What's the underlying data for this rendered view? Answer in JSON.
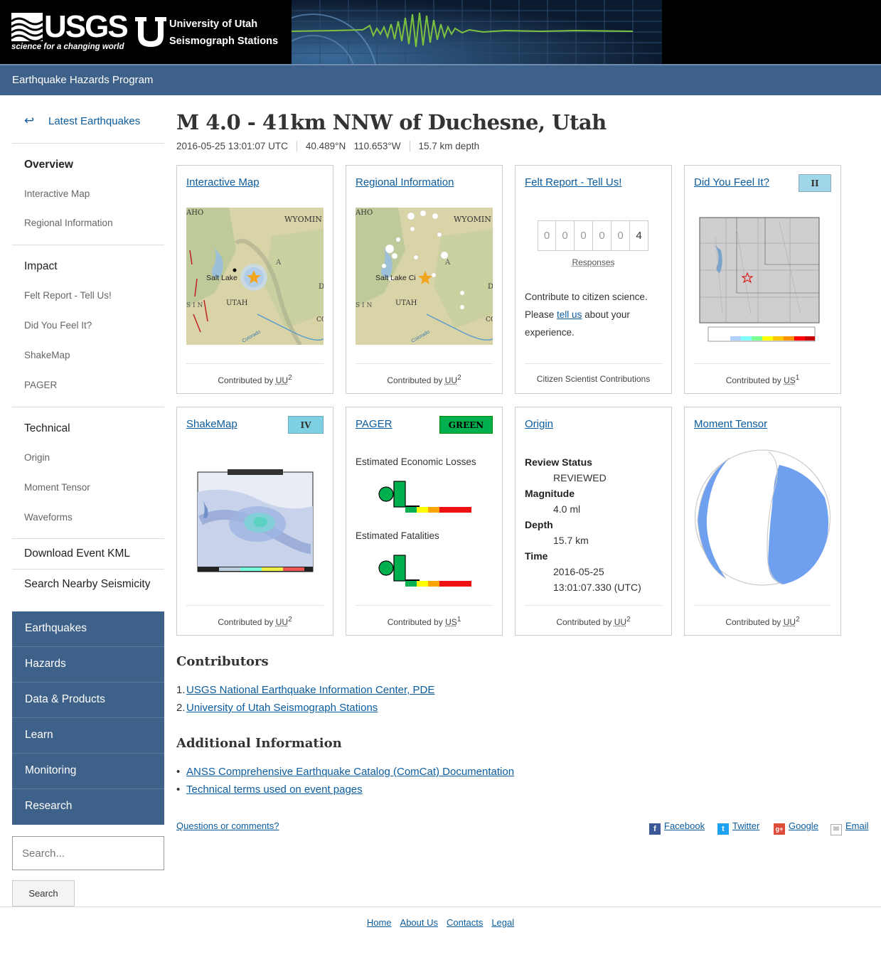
{
  "header": {
    "usgs_logo": "USGS",
    "usgs_tagline": "science for a changing world",
    "uu_line1": "University of Utah",
    "uu_line2": "Seismograph Stations",
    "program": "Earthquake Hazards Program"
  },
  "sidebar": {
    "back_label": "Latest Earthquakes",
    "overview": "Overview",
    "overview_items": [
      "Interactive Map",
      "Regional Information"
    ],
    "impact": "Impact",
    "impact_items": [
      "Felt Report - Tell Us!",
      "Did You Feel It?",
      "ShakeMap",
      "PAGER"
    ],
    "technical": "Technical",
    "technical_items": [
      "Origin",
      "Moment Tensor",
      "Waveforms"
    ],
    "download_kml": "Download Event KML",
    "search_nearby": "Search Nearby Seismicity",
    "section_nav": [
      "Earthquakes",
      "Hazards",
      "Data & Products",
      "Learn",
      "Monitoring",
      "Research"
    ],
    "search_placeholder": "Search...",
    "search_button": "Search"
  },
  "event": {
    "title": "M 4.0 - 41km NNW of Duchesne, Utah",
    "time": "2016-05-25 13:01:07 UTC",
    "lat": "40.489°N",
    "lon": "110.653°W",
    "depth": "15.7 km depth"
  },
  "cards": {
    "interactive_map": {
      "title": "Interactive Map",
      "contrib": "Contributed by",
      "network": "UU",
      "num": "2"
    },
    "regional": {
      "title": "Regional Information",
      "contrib": "Contributed by",
      "network": "UU",
      "num": "2"
    },
    "felt": {
      "title": "Felt Report - Tell Us!",
      "digits": [
        "0",
        "0",
        "0",
        "0",
        "0",
        "4"
      ],
      "responses": "Responses",
      "text1": "Contribute to citizen science.",
      "text2": "Please",
      "link": "tell us",
      "text3": "about your",
      "text4": "experience.",
      "footer": "Citizen Scientist Contributions"
    },
    "dyfi": {
      "title": "Did You Feel It?",
      "badge": "II",
      "contrib": "Contributed by",
      "network": "US",
      "num": "1"
    },
    "shakemap": {
      "title": "ShakeMap",
      "badge": "IV",
      "contrib": "Contributed by",
      "network": "UU",
      "num": "2"
    },
    "pager": {
      "title": "PAGER",
      "badge": "GREEN",
      "losses": "Estimated Economic Losses",
      "fatalities": "Estimated Fatalities",
      "contrib": "Contributed by",
      "network": "US",
      "num": "1"
    },
    "origin": {
      "title": "Origin",
      "review_label": "Review Status",
      "review": "REVIEWED",
      "mag_label": "Magnitude",
      "mag": "4.0 ml",
      "depth_label": "Depth",
      "depth": "15.7 km",
      "time_label": "Time",
      "date": "2016-05-25",
      "time": "13:01:07.330 (UTC)",
      "contrib": "Contributed by",
      "network": "UU",
      "num": "2"
    },
    "moment": {
      "title": "Moment Tensor",
      "contrib": "Contributed by",
      "network": "UU",
      "num": "2"
    }
  },
  "map_labels": {
    "idaho": "AHO",
    "wyoming": "WYOMIN",
    "saltlake": "Salt Lake",
    "saltlake2": "Salt Lake Ci",
    "utah": "UTAH",
    "colorado": "Colorado",
    "a": "A",
    "d": "D",
    "co": "CO",
    "sin": "S I N"
  },
  "contributors": {
    "heading": "Contributors",
    "items": [
      "USGS National Earthquake Information Center, PDE",
      "University of Utah Seismograph Stations"
    ]
  },
  "additional": {
    "heading": "Additional Information",
    "items": [
      "ANSS Comprehensive Earthquake Catalog (ComCat) Documentation",
      "Technical terms used on event pages"
    ]
  },
  "footer": {
    "questions": "Questions or comments?",
    "facebook": "Facebook",
    "twitter": "Twitter",
    "google": "Google",
    "email": "Email",
    "links": [
      "Home",
      "About Us",
      "Contacts",
      "Legal"
    ]
  },
  "colors": {
    "nav_blue": "#3e6189",
    "link": "#0b5c9e",
    "dyfi_badge": "#a0d7e8",
    "shake_badge": "#7fd0e2",
    "pager_green": "#00b04f",
    "tensor_fill": "#6fa0f0"
  }
}
